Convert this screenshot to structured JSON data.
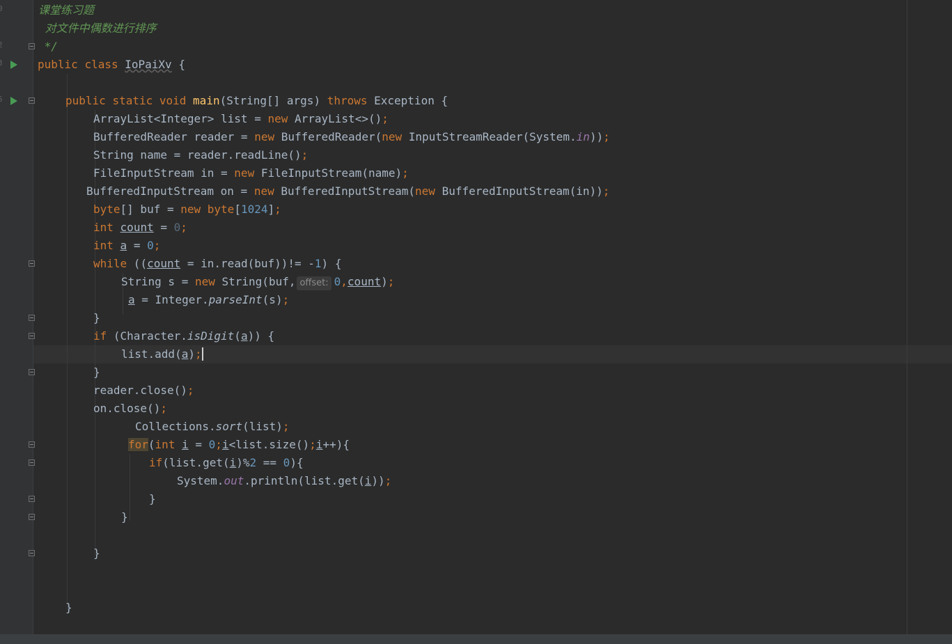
{
  "gutter": {
    "line_number_fragments": [
      "0",
      "",
      "2",
      "3",
      "",
      "5",
      "",
      "",
      "",
      "",
      "",
      "",
      "",
      "",
      "",
      "",
      "",
      "",
      "",
      "",
      "",
      "",
      "",
      "",
      "",
      "",
      "",
      "",
      "",
      "",
      "",
      "",
      "",
      ""
    ]
  },
  "code": {
    "l0": "课堂练习题",
    "l1": " 对文件中偶数进行排序",
    "l2": " */",
    "l3_public": "public",
    "l3_class": "class",
    "l3_name": "IoPaiXv",
    "l3_brace": " {",
    "l5_public": "public",
    "l5_static": "static",
    "l5_void": "void",
    "l5_main": "main",
    "l5_args": "(String[] args) ",
    "l5_throws": "throws",
    "l5_exc": " Exception {",
    "l6_a": "ArrayList<Integer> list = ",
    "l6_new": "new",
    "l6_b": " ArrayList<>()",
    "l7_a": "BufferedReader reader = ",
    "l7_new": "new",
    "l7_b": " BufferedReader(",
    "l7_new2": "new",
    "l7_c": " InputStreamReader(System.",
    "l7_in": "in",
    "l7_d": "))",
    "l8_a": "String name = reader.readLine()",
    "l9_a": "FileInputStream in = ",
    "l9_new": "new",
    "l9_b": " FileInputStream(name)",
    "l10_a": "BufferedInputStream on = ",
    "l10_new": "new",
    "l10_b": " BufferedInputStream(",
    "l10_new2": "new",
    "l10_c": " BufferedInputStream(in))",
    "l11_byte": "byte",
    "l11_a": "[] buf = ",
    "l11_new": "new",
    "l11_byte2": "byte",
    "l11_b": "[",
    "l11_num": "1024",
    "l11_c": "]",
    "l12_int": "int",
    "l12_var": "count",
    "l12_eq": " = ",
    "l12_num": "0",
    "l13_int": "int",
    "l13_var": "a",
    "l13_eq": " = ",
    "l13_num": "0",
    "l14_while": "while",
    "l14_a": " ((",
    "l14_var": "count",
    "l14_b": " = in.read(buf))!= -",
    "l14_num": "1",
    "l14_c": ") {",
    "l15_a": "String s = ",
    "l15_new": "new",
    "l15_b": " String(buf,",
    "l15_hint": "offset:",
    "l15_num": "0",
    "l15_comma": ",",
    "l15_var": "count",
    "l15_c": ")",
    "l16_var": "a",
    "l16_a": " = Integer.",
    "l16_fn": "parseInt",
    "l16_b": "(s)",
    "l17": "}",
    "l18_if": "if",
    "l18_a": " (Character.",
    "l18_fn": "isDigit",
    "l18_b": "(",
    "l18_var": "a",
    "l18_c": ")) {",
    "l19_a": "list.add(",
    "l19_var": "a",
    "l19_b": ")",
    "l20": "}",
    "l21_a": "reader.close()",
    "l22_a": "on.close()",
    "l23_a": "Collections.",
    "l23_fn": "sort",
    "l23_b": "(list)",
    "l24_for": "for",
    "l24_a": "(",
    "l24_int": "int",
    "l24_var1": "i",
    "l24_eq": " = ",
    "l24_num": "0",
    "l24_var2": "i",
    "l24_b": "<list.size()",
    "l24_var3": "i",
    "l24_c": "++){",
    "l25_if": "if",
    "l25_a": "(list.get(",
    "l25_var": "i",
    "l25_b": ")%",
    "l25_num1": "2",
    "l25_c": " == ",
    "l25_num2": "0",
    "l25_d": "){",
    "l26_a": "System.",
    "l26_out": "out",
    "l26_b": ".println(list.get(",
    "l26_var": "i",
    "l26_c": "))",
    "l27": "}",
    "l28": "}",
    "l30": "}",
    "l33": "}",
    "semi": ";",
    "sp": " "
  }
}
